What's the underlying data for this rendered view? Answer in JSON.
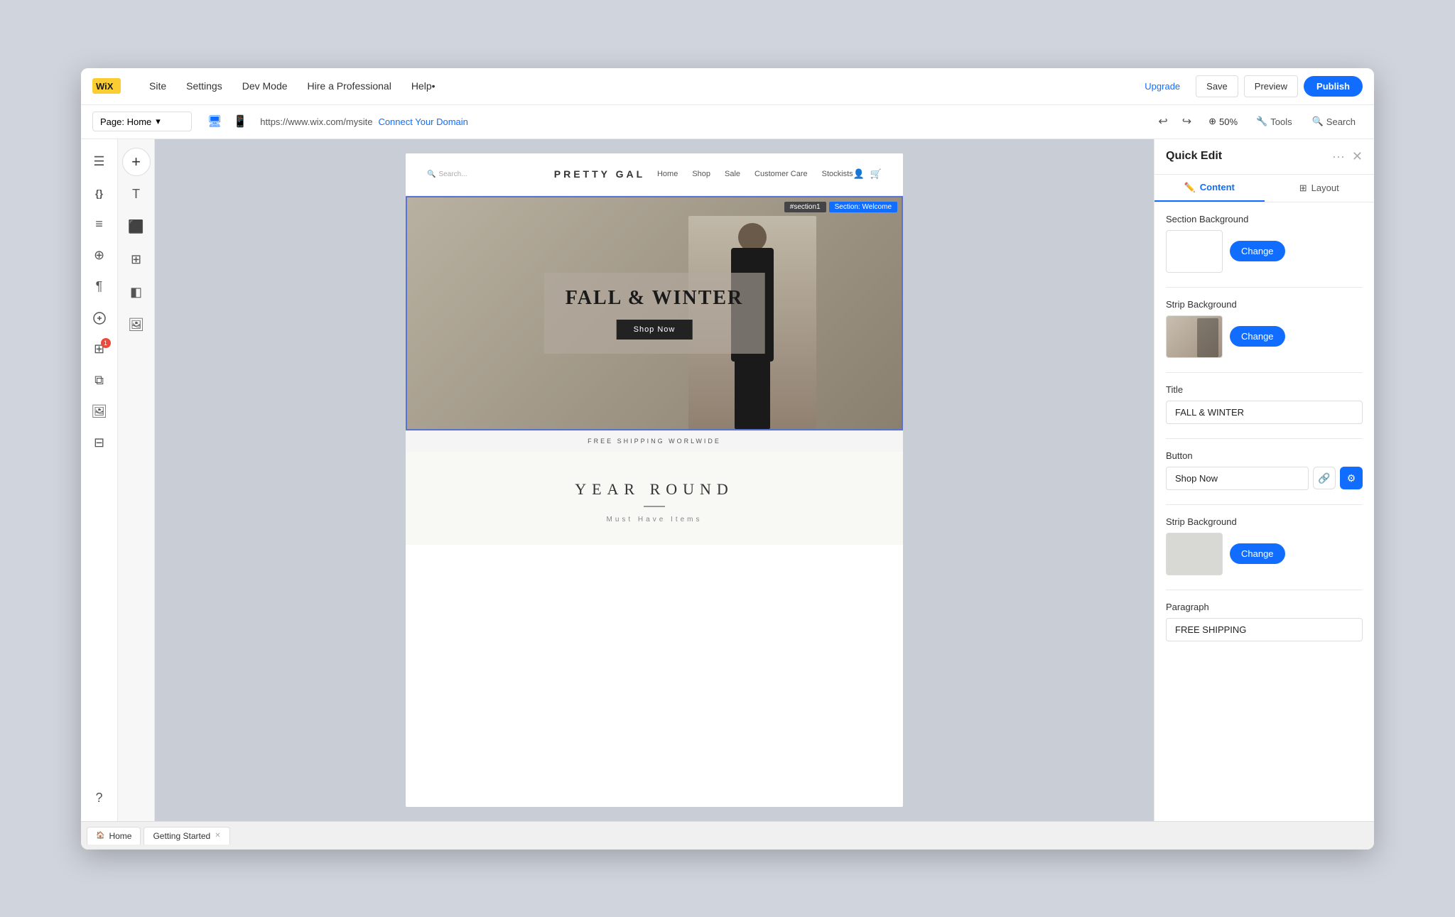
{
  "topBar": {
    "nav": [
      {
        "label": "Site",
        "id": "site"
      },
      {
        "label": "Settings",
        "id": "settings"
      },
      {
        "label": "Dev Mode",
        "id": "dev-mode"
      },
      {
        "label": "Hire a Professional",
        "id": "hire"
      },
      {
        "label": "Help•",
        "id": "help"
      }
    ],
    "upgrade": "Upgrade",
    "save": "Save",
    "preview": "Preview",
    "publish": "Publish"
  },
  "secondBar": {
    "page": "Page: Home",
    "url": "https://www.wix.com/mysite",
    "connect": "Connect Your Domain",
    "zoom": "50%",
    "tools": "Tools",
    "search": "Search"
  },
  "leftIcons": [
    {
      "name": "pages-icon",
      "symbol": "☰",
      "badge": null
    },
    {
      "name": "design-icon",
      "symbol": "{}",
      "badge": null
    },
    {
      "name": "layers-icon",
      "symbol": "≡",
      "badge": null
    },
    {
      "name": "zoom-icon",
      "symbol": "⊕",
      "badge": null
    },
    {
      "name": "text-icon",
      "symbol": "¶",
      "badge": null
    },
    {
      "name": "ai-icon",
      "symbol": "⬡",
      "badge": null
    },
    {
      "name": "grid-icon",
      "symbol": "⊞",
      "badge": "1"
    },
    {
      "name": "puzzle-icon",
      "symbol": "⧉",
      "badge": null
    },
    {
      "name": "media-icon",
      "symbol": "🖼",
      "badge": null
    },
    {
      "name": "table-icon",
      "symbol": "⊟",
      "badge": null
    },
    {
      "name": "help-icon",
      "symbol": "?",
      "badge": null
    }
  ],
  "toolPanel": [
    {
      "name": "add-btn",
      "symbol": "+"
    },
    {
      "name": "text-tool",
      "symbol": "T"
    },
    {
      "name": "image-tool",
      "symbol": "⬛"
    },
    {
      "name": "layout-tool",
      "symbol": "⊞"
    },
    {
      "name": "widget-tool",
      "symbol": "◧"
    },
    {
      "name": "media-tool",
      "symbol": "🖼"
    }
  ],
  "canvas": {
    "siteHeader": {
      "logo": "PRETTY GAL",
      "nav": [
        "Home",
        "Shop",
        "Sale",
        "Customer Care",
        "Stockists"
      ],
      "searchPlaceholder": "Search..."
    },
    "heroSection": {
      "id": "#section1",
      "name": "Section: Welcome",
      "title": "FALL & WINTER",
      "button": "Shop Now",
      "shippingBar": "FREE SHIPPING WORLWIDE"
    },
    "yearRound": {
      "title": "YEAR ROUND",
      "subtitle": "Must Have Items"
    }
  },
  "quickEdit": {
    "title": "Quick Edit",
    "tabs": [
      {
        "label": "Content",
        "icon": "✏️",
        "id": "content"
      },
      {
        "label": "Layout",
        "icon": "⊞",
        "id": "layout"
      }
    ],
    "activeTab": "content",
    "sections": [
      {
        "label": "Section Background",
        "type": "background",
        "preview": "white",
        "changeBtn": "Change"
      },
      {
        "label": "Strip Background",
        "type": "strip",
        "preview": "image",
        "changeBtn": "Change"
      },
      {
        "label": "Title",
        "type": "input",
        "value": "FALL & WINTER"
      },
      {
        "label": "Button",
        "type": "input-with-icons",
        "value": "Shop Now"
      },
      {
        "label": "Strip Background",
        "type": "strip2",
        "preview": "gray",
        "changeBtn": "Change"
      },
      {
        "label": "Paragraph",
        "type": "input",
        "value": "FREE SHIPPING"
      }
    ]
  },
  "bottomTabs": [
    {
      "label": "Home",
      "id": "home",
      "icon": "🏠",
      "closable": false
    },
    {
      "label": "Getting Started",
      "id": "getting-started",
      "closable": true
    }
  ]
}
